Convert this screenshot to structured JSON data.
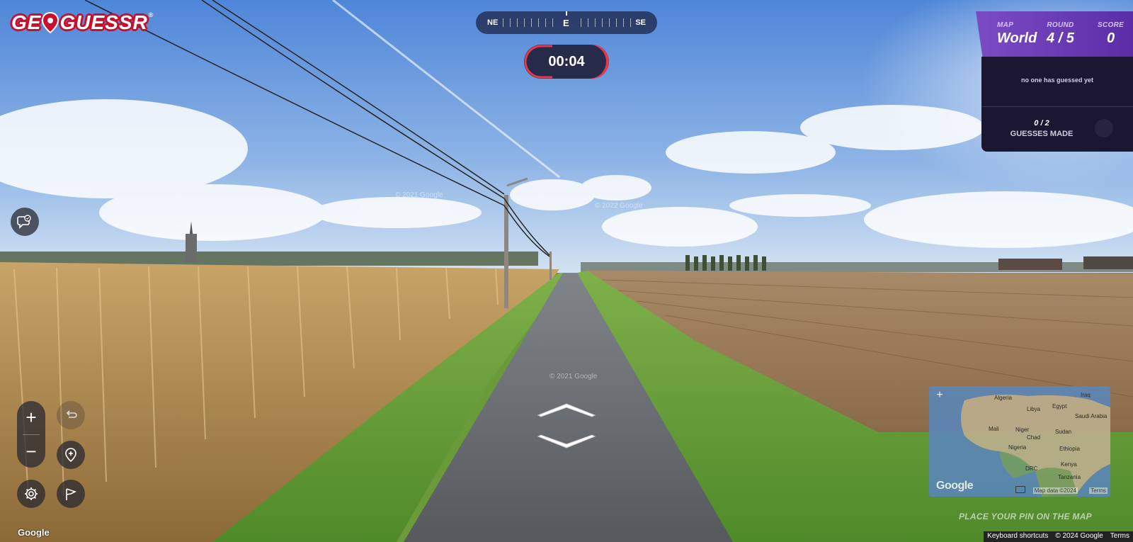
{
  "logo": {
    "text_left": "GE",
    "text_right": "GUESSR",
    "registered": "®"
  },
  "compass": {
    "left": "NE",
    "center": "E",
    "right": "SE"
  },
  "timer": {
    "value": "00:04"
  },
  "status": {
    "map_caption": "MAP",
    "map_value": "World",
    "round_caption": "ROUND",
    "round_value": "4 / 5",
    "score_caption": "SCORE",
    "score_value": "0"
  },
  "guesses": {
    "message": "no one has guessed yet",
    "count": "0 / 2",
    "label": "GUESSES MADE"
  },
  "controls": {
    "zoom_in": "+",
    "zoom_out": "−"
  },
  "watermarks": [
    "© 2021 Google",
    "© 2022 Google",
    "© 2021 Google"
  ],
  "minimap": {
    "countries": [
      "Algeria",
      "Libya",
      "Egypt",
      "Iraq",
      "Saudi Arabia",
      "Mali",
      "Niger",
      "Chad",
      "Sudan",
      "Nigeria",
      "Ethiopia",
      "Kenya",
      "DRC",
      "Tanzania"
    ],
    "logo": "Google",
    "map_data": "Map data ©2024",
    "terms": "Terms",
    "zoom_plus": "+"
  },
  "place_pin": "PLACE YOUR PIN ON THE MAP",
  "footer": {
    "google": "Google",
    "keyboard": "Keyboard shortcuts",
    "copyright": "© 2024 Google",
    "terms": "Terms"
  },
  "colors": {
    "brand_red": "#c8102e",
    "panel_purple": "#6a3cb5",
    "panel_dark": "#1b1733",
    "timer_bg": "#272b4a",
    "timer_accent": "#e8374a"
  }
}
